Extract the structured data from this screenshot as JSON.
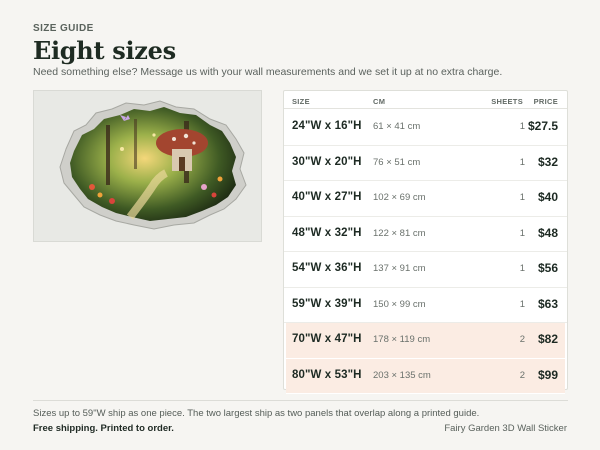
{
  "header": {
    "eyebrow": "SIZE GUIDE",
    "title": "Eight sizes",
    "subtitle": "Need something else? Message us with your wall measurements and we set it up at no extra charge."
  },
  "image": {
    "description_icon": "fairy-garden-wall-sticker-image"
  },
  "table": {
    "headers": {
      "size": "SIZE",
      "cm": "CM",
      "sheets": "SHEETS",
      "price": "PRICE"
    },
    "rows": [
      {
        "size": "24\"W x 16\"H",
        "cm": "61 × 41 cm",
        "sheets": "1",
        "price": "$27.5",
        "highlight": false
      },
      {
        "size": "30\"W x 20\"H",
        "cm": "76 × 51 cm",
        "sheets": "1",
        "price": "$32",
        "highlight": false
      },
      {
        "size": "40\"W x 27\"H",
        "cm": "102 × 69 cm",
        "sheets": "1",
        "price": "$40",
        "highlight": false
      },
      {
        "size": "48\"W x 32\"H",
        "cm": "122 × 81 cm",
        "sheets": "1",
        "price": "$48",
        "highlight": false
      },
      {
        "size": "54\"W x 36\"H",
        "cm": "137 × 91 cm",
        "sheets": "1",
        "price": "$56",
        "highlight": false
      },
      {
        "size": "59\"W x 39\"H",
        "cm": "150 × 99 cm",
        "sheets": "1",
        "price": "$63",
        "highlight": false
      },
      {
        "size": "70\"W x 47\"H",
        "cm": "178 × 119 cm",
        "sheets": "2",
        "price": "$82",
        "highlight": true
      },
      {
        "size": "80\"W x 53\"H",
        "cm": "203 × 135 cm",
        "sheets": "2",
        "price": "$99",
        "highlight": true
      }
    ]
  },
  "footer": {
    "note": "Sizes up to 59\"W ship as one piece. The two largest ship as two panels that overlap along a printed guide.",
    "shipping": "Free shipping. Printed to order.",
    "product": "Fairy Garden 3D Wall Sticker"
  },
  "colors": {
    "highlight_row": "#fbece3",
    "title": "#1e2b22",
    "background": "#f6f5f2"
  }
}
